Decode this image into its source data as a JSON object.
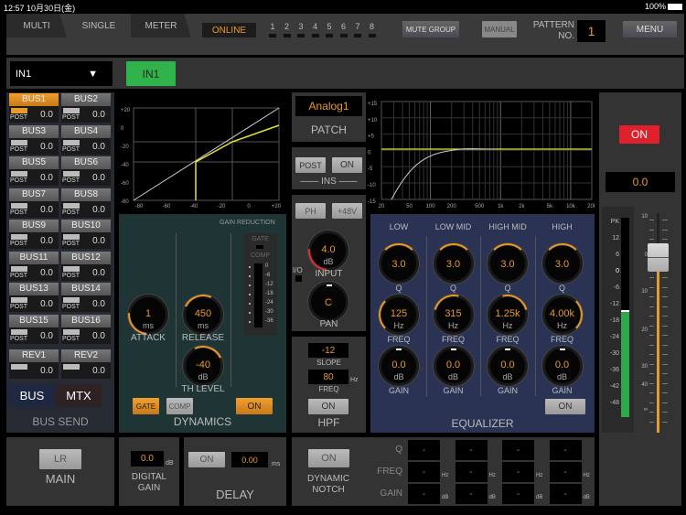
{
  "status_bar": {
    "time": "12:57",
    "date": "10月30日(金)",
    "battery": "100%"
  },
  "tabs": [
    {
      "label": "MULTI"
    },
    {
      "label": "SINGLE",
      "active": true
    },
    {
      "label": "METER"
    }
  ],
  "header": {
    "online": "ONLINE",
    "mute_groups": [
      "1",
      "2",
      "3",
      "4",
      "5",
      "6",
      "7",
      "8"
    ],
    "mute_group_button": "MUTE GROUP",
    "manual_button": "MANUAL",
    "pattern_label_1": "PATTERN",
    "pattern_label_2": "NO.",
    "pattern_no": "1",
    "menu_button": "MENU"
  },
  "channel": {
    "selected": "IN1",
    "name": "IN1"
  },
  "bus_send": {
    "title": "BUS SEND",
    "buses": [
      {
        "name": "BUS1",
        "mode": "POST",
        "value": "0.0",
        "on": true
      },
      {
        "name": "BUS2",
        "mode": "POST",
        "value": "0.0"
      },
      {
        "name": "BUS3",
        "mode": "POST",
        "value": "0.0"
      },
      {
        "name": "BUS4",
        "mode": "POST",
        "value": "0.0"
      },
      {
        "name": "BUS5",
        "mode": "POST",
        "value": "0.0"
      },
      {
        "name": "BUS6",
        "mode": "POST",
        "value": "0.0"
      },
      {
        "name": "BUS7",
        "mode": "POST",
        "value": "0.0"
      },
      {
        "name": "BUS8",
        "mode": "POST",
        "value": "0.0"
      },
      {
        "name": "BUS9",
        "mode": "POST",
        "value": "0.0"
      },
      {
        "name": "BUS10",
        "mode": "POST",
        "value": "0.0"
      },
      {
        "name": "BUS11",
        "mode": "POST",
        "value": "0.0"
      },
      {
        "name": "BUS12",
        "mode": "POST",
        "value": "0.0"
      },
      {
        "name": "BUS13",
        "mode": "POST",
        "value": "0.0"
      },
      {
        "name": "BUS14",
        "mode": "POST",
        "value": "0.0"
      },
      {
        "name": "BUS15",
        "mode": "POST",
        "value": "0.0"
      },
      {
        "name": "BUS16",
        "mode": "POST",
        "value": "0.0"
      },
      {
        "name": "REV1",
        "mode": "",
        "value": "0.0"
      },
      {
        "name": "REV2",
        "mode": "",
        "value": "0.0"
      }
    ],
    "tab_bus": "BUS",
    "tab_mtx": "MTX"
  },
  "dyn_graph": {
    "x_ticks": [
      "-80",
      "-60",
      "-40",
      "-20",
      "0",
      "+20"
    ],
    "y_ticks": [
      "+20",
      "0",
      "-20",
      "-40",
      "-60",
      "-80"
    ]
  },
  "dynamics": {
    "title": "DYNAMICS",
    "gain_reduction": "GAIN REDUCTION",
    "gate_label": "GATE",
    "comp_label": "COMP",
    "gr_scale": [
      "0",
      "-6",
      "-12",
      "-18",
      "-24",
      "-30",
      "-36"
    ],
    "attack": {
      "value": "1",
      "unit": "ms",
      "label": "ATTACK"
    },
    "release": {
      "value": "450",
      "unit": "ms",
      "label": "RELEASE"
    },
    "threshold": {
      "value": "-40",
      "unit": "dB",
      "label": "TH LEVEL"
    },
    "gate_button": "GATE",
    "comp_button": "COMP",
    "on_button": "ON"
  },
  "patch": {
    "value": "Analog1",
    "label": "PATCH"
  },
  "ins": {
    "post": "POST",
    "on": "ON",
    "label": "INS"
  },
  "input": {
    "ph": "PH",
    "phantom": "+48V",
    "gain": "4.0",
    "gain_unit": "dB",
    "gain_label": "INPUT",
    "io": "I/O",
    "pan": "C",
    "pan_label": "PAN"
  },
  "hpf": {
    "slope": "-12",
    "slope_label": "SLOPE",
    "freq": "80",
    "freq_unit": "Hz",
    "freq_label": "FREQ",
    "on": "ON",
    "title": "HPF"
  },
  "eq_graph": {
    "x_ticks": [
      "20",
      "50",
      "100",
      "200",
      "500",
      "1k",
      "2k",
      "5k",
      "10k",
      "20k"
    ],
    "y_ticks": [
      "+15",
      "+10",
      "+5",
      "0",
      "-5",
      "-10",
      "-15"
    ]
  },
  "equalizer": {
    "title": "EQUALIZER",
    "on": "ON",
    "bands": [
      {
        "name": "LOW",
        "q": "3.0",
        "freq": "125",
        "gain": "0.0"
      },
      {
        "name": "LOW MID",
        "q": "3.0",
        "freq": "315",
        "gain": "0.0"
      },
      {
        "name": "HIGH MID",
        "q": "3.0",
        "freq": "1.25k",
        "gain": "0.0"
      },
      {
        "name": "HIGH",
        "q": "3.0",
        "freq": "4.00k",
        "gain": "0.0"
      }
    ],
    "q_label": "Q",
    "freq_label": "FREQ",
    "gain_label": "GAIN",
    "hz": "Hz",
    "db": "dB"
  },
  "fader": {
    "on": "ON",
    "level": "0.0",
    "meter_scale": [
      "PK",
      "12",
      "6",
      "0",
      "-6",
      "-12",
      "-18",
      "-24",
      "-30",
      "-36",
      "-42",
      "-48"
    ],
    "fader_scale": [
      "10",
      "0",
      "10",
      "20",
      "30",
      "40",
      "∞"
    ],
    "meter_level_db": -15
  },
  "main": {
    "lr": "LR",
    "label": "MAIN"
  },
  "digital_gain": {
    "value": "0.0",
    "unit": "dB",
    "label1": "DIGITAL",
    "label2": "GAIN"
  },
  "delay": {
    "on": "ON",
    "value": "0.00",
    "unit": "ms",
    "label": "DELAY"
  },
  "notch": {
    "on": "ON",
    "label1": "DYNAMIC",
    "label2": "NOTCH",
    "q_label": "Q",
    "freq_label": "FREQ",
    "gain_label": "GAIN",
    "hz": "Hz",
    "db": "dB",
    "empty": "-"
  },
  "colors": {
    "accent": "#e89a2a",
    "green": "#2fb34a",
    "red": "#e0202a",
    "eq_bg": "#2b3355",
    "dyn_bg": "#1f3535"
  }
}
